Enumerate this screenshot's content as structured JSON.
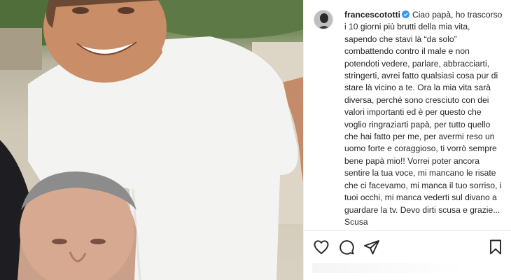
{
  "post": {
    "username": "francescototti",
    "caption": "Ciao papà, ho trascorso i 10 giorni più brutti della mia vita, sapendo che stavi là “da solo” combattendo contro il male e non potendoti vedere, parlare, abbracciarti, stringerti, avrei fatto qualsiasi cosa pur di stare là vicino a te. Ora la mia vita sarà diversa, perché sono cresciuto con dei valori importanti ed è per questo che voglio ringraziarti papà, per tutto quello che hai fatto per me, per avermi reso un uomo forte e coraggioso, ti vorrò sempre bene papà mio!! Vorrei poter ancora sentire la tua voce, mi mancano le risate che ci facevamo, mi manca il tuo sorriso, i tuoi occhi, mi manca vederti sul divano a guardare la tv. Devo dirti scusa e grazie... Scusa"
  },
  "icons": {
    "verified": "verified-badge-icon",
    "like": "heart-icon",
    "comment": "comment-icon",
    "share": "paper-plane-icon",
    "save": "bookmark-icon"
  },
  "colors": {
    "text": "#262626",
    "verified": "#3897f0",
    "border": "#efefef"
  }
}
